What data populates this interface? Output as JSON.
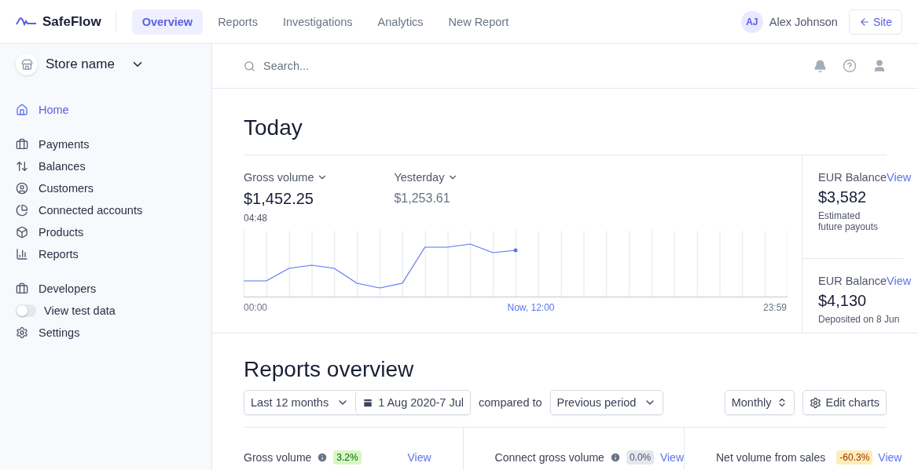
{
  "brand": {
    "name": "SafeFlow"
  },
  "nav_tabs": [
    {
      "label": "Overview",
      "selected": true
    },
    {
      "label": "Reports",
      "selected": false
    },
    {
      "label": "Investigations",
      "selected": false
    },
    {
      "label": "Analytics",
      "selected": false
    },
    {
      "label": "New Report",
      "selected": false
    }
  ],
  "user": {
    "initials": "AJ",
    "name": "Alex Johnson"
  },
  "site_button": {
    "label": "Site"
  },
  "sidebar": {
    "store": "Store name",
    "groups": [
      [
        {
          "kind": "link",
          "label": "Home",
          "selected": true
        }
      ],
      [
        {
          "kind": "link",
          "label": "Payments",
          "selected": false
        },
        {
          "kind": "link",
          "label": "Balances",
          "selected": false
        },
        {
          "kind": "link",
          "label": "Customers",
          "selected": false
        },
        {
          "kind": "link",
          "label": "Connected accounts",
          "selected": false
        },
        {
          "kind": "link",
          "label": "Products",
          "selected": false
        },
        {
          "kind": "link",
          "label": "Reports",
          "selected": false
        }
      ],
      [
        {
          "kind": "link",
          "label": "Developers",
          "selected": false
        },
        {
          "kind": "toggle",
          "label": "View test data",
          "on": false
        },
        {
          "kind": "link",
          "label": "Settings",
          "selected": false
        }
      ]
    ]
  },
  "search": {
    "placeholder": "Search..."
  },
  "today": {
    "title": "Today",
    "primary": {
      "label": "Gross volume",
      "value": "$1,452.25",
      "time": "04:48"
    },
    "compare": {
      "label": "Yesterday",
      "value": "$1,253.61"
    },
    "axis": {
      "start": "00:00",
      "now": "Now, 12:00",
      "end": "23:59"
    },
    "balances": [
      {
        "label": "EUR Balance",
        "link": "View",
        "value": "$3,582",
        "note": "Estimated future payouts"
      },
      {
        "label": "EUR Balance",
        "link": "View",
        "value": "$4,130",
        "note": "Deposited on 8 Jun"
      }
    ]
  },
  "reports": {
    "title": "Reports overview",
    "range": "Last 12 months",
    "dates": "1 Aug 2020-7 Jul",
    "compared_label": "compared to",
    "compare": "Previous period",
    "interval": "Monthly",
    "edit": "Edit charts",
    "metrics": [
      {
        "label": "Gross volume",
        "badge": "3.2%",
        "kind": "positive",
        "link": "View"
      },
      {
        "label": "Connect gross volume",
        "badge": "0.0%",
        "kind": "neutral",
        "link": "View"
      },
      {
        "label": "Net volume from sales",
        "badge": "-60.3%",
        "kind": "negative",
        "link": "View"
      }
    ]
  }
}
